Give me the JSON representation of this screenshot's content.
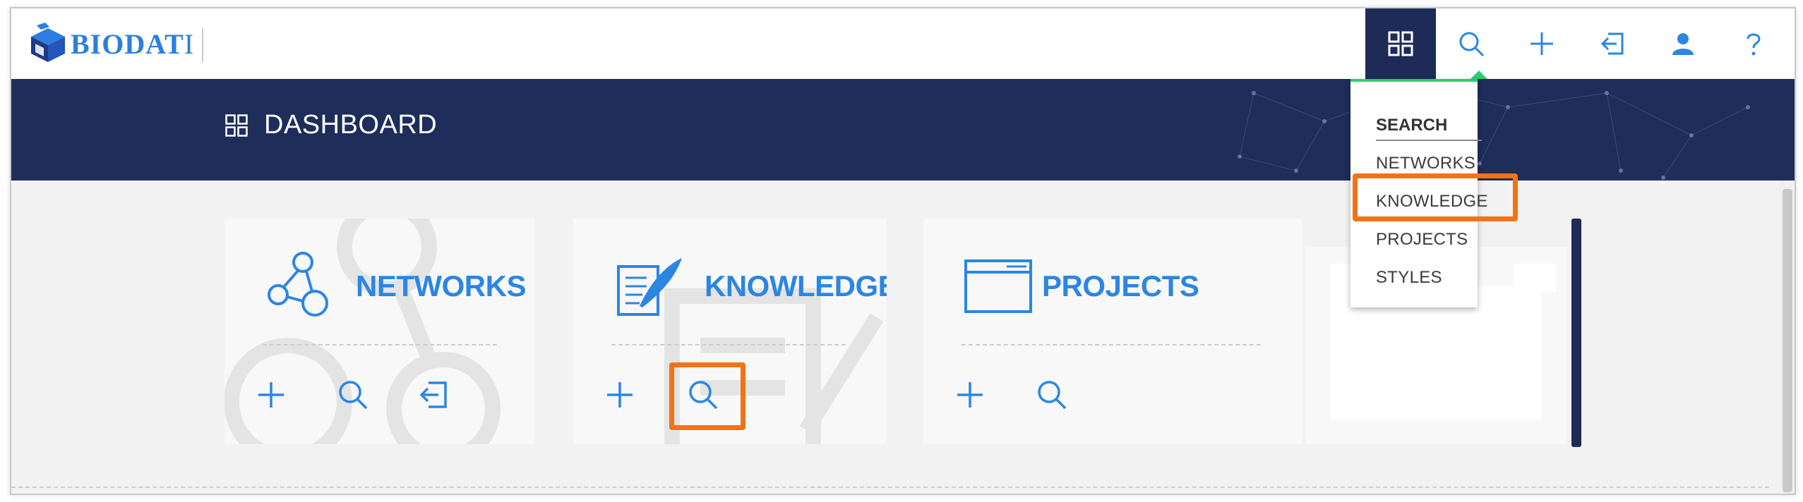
{
  "brand": {
    "logo_text_main": "BIODAT",
    "logo_text_tail": "I"
  },
  "nav": {
    "items": [
      {
        "name": "dashboard",
        "icon": "grid-icon",
        "active": true
      },
      {
        "name": "search",
        "icon": "search-icon",
        "active": false
      },
      {
        "name": "create",
        "icon": "plus-icon",
        "active": false
      },
      {
        "name": "import",
        "icon": "import-icon",
        "active": false
      },
      {
        "name": "user",
        "icon": "user-icon",
        "active": false
      },
      {
        "name": "help",
        "icon": "help-icon",
        "active": false
      }
    ]
  },
  "header": {
    "title": "DASHBOARD",
    "icon": "grid-icon"
  },
  "cards": [
    {
      "title": "NETWORKS",
      "icon": "network-icon",
      "actions": [
        "plus-icon",
        "search-icon",
        "import-icon"
      ]
    },
    {
      "title": "KNOWLEDGE",
      "icon": "knowledge-icon",
      "actions": [
        "plus-icon",
        "search-icon"
      ]
    },
    {
      "title": "PROJECTS",
      "icon": "window-icon",
      "actions": [
        "plus-icon",
        "search-icon"
      ]
    }
  ],
  "search_menu": {
    "heading": "SEARCH",
    "items": [
      "NETWORKS",
      "KNOWLEDGE",
      "PROJECTS",
      "STYLES"
    ],
    "highlighted": "KNOWLEDGE"
  },
  "colors": {
    "navy": "#1e2d5a",
    "accent_blue": "#2b86e3",
    "highlight_orange": "#f47216",
    "caret_green": "#2ecc71"
  }
}
